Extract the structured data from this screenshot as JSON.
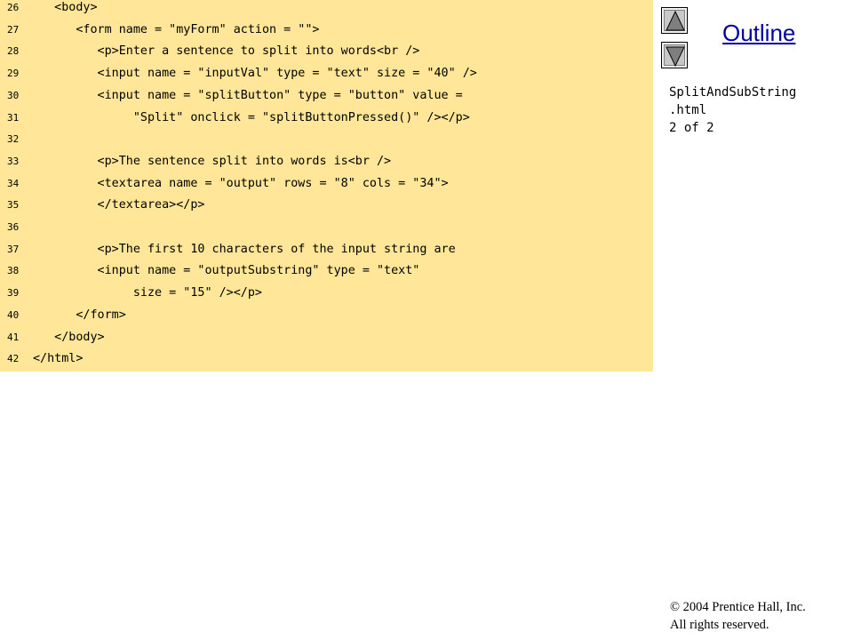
{
  "code_lines": [
    {
      "num": "26",
      "text": "   <body>"
    },
    {
      "num": "27",
      "text": "      <form name = \"myForm\" action = \"\">"
    },
    {
      "num": "28",
      "text": "         <p>Enter a sentence to split into words<br />"
    },
    {
      "num": "29",
      "text": "         <input name = \"inputVal\" type = \"text\" size = \"40\" />"
    },
    {
      "num": "30",
      "text": "         <input name = \"splitButton\" type = \"button\" value ="
    },
    {
      "num": "31",
      "text": "              \"Split\" onclick = \"splitButtonPressed()\" /></p>"
    },
    {
      "num": "32",
      "text": ""
    },
    {
      "num": "33",
      "text": "         <p>The sentence split into words is<br />"
    },
    {
      "num": "34",
      "text": "         <textarea name = \"output\" rows = \"8\" cols = \"34\">"
    },
    {
      "num": "35",
      "text": "         </textarea></p>"
    },
    {
      "num": "36",
      "text": ""
    },
    {
      "num": "37",
      "text": "         <p>The first 10 characters of the input string are"
    },
    {
      "num": "38",
      "text": "         <input name = \"outputSubstring\" type = \"text\""
    },
    {
      "num": "39",
      "text": "              size = \"15\" /></p>"
    },
    {
      "num": "40",
      "text": "      </form>"
    },
    {
      "num": "41",
      "text": "   </body>"
    },
    {
      "num": "42",
      "text": "</html>"
    }
  ],
  "sidebar": {
    "outline_label": "Outline",
    "file_line1": "SplitAndSubString",
    "file_line2": ".html",
    "page_info": "2 of 2",
    "up_icon": "triangle-up-icon",
    "down_icon": "triangle-down-icon"
  },
  "footer": {
    "copyright_symbol": "©",
    "copyright_line1": " 2004 Prentice Hall, Inc.",
    "copyright_line2": "All rights reserved."
  },
  "colors": {
    "code_background": "#FFE699",
    "outline_link": "#0000A0"
  }
}
